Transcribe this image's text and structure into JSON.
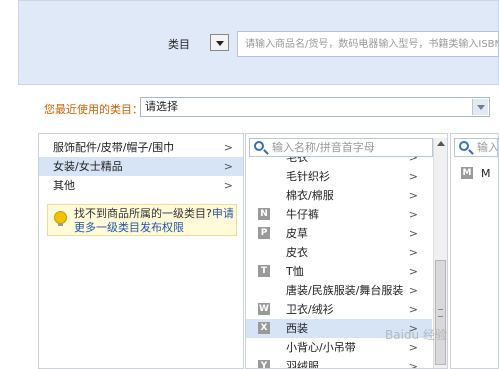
{
  "search": {
    "category_label": "类目",
    "placeholder": "请输入商品名/货号，数码电器输入型号，书籍类输入ISBN"
  },
  "recent": {
    "label": "您最近使用的类目：",
    "value": "请选择"
  },
  "level1": {
    "items": [
      {
        "label": "服饰配件/皮带/帽子/围巾",
        "selected": false
      },
      {
        "label": "女装/女士精品",
        "selected": true
      },
      {
        "label": "其他",
        "selected": false
      }
    ],
    "hint": {
      "text": "找不到商品所属的一级类目?",
      "link": "申请更多一级类目发布权限"
    }
  },
  "level2": {
    "search_placeholder": "输入名称/拼音首字母",
    "items": [
      {
        "letter": "",
        "label": "毛衣"
      },
      {
        "letter": "",
        "label": "毛针织衫"
      },
      {
        "letter": "",
        "label": "棉衣/棉服"
      },
      {
        "letter": "N",
        "label": "牛仔裤"
      },
      {
        "letter": "P",
        "label": "皮草"
      },
      {
        "letter": "",
        "label": "皮衣"
      },
      {
        "letter": "T",
        "label": "T恤"
      },
      {
        "letter": "",
        "label": "唐装/民族服装/舞台服装"
      },
      {
        "letter": "W",
        "label": "卫衣/绒衫"
      },
      {
        "letter": "X",
        "label": "西装",
        "selected": true
      },
      {
        "letter": "",
        "label": "小背心/小吊带"
      },
      {
        "letter": "Y",
        "label": "羽绒服"
      }
    ]
  },
  "level3": {
    "search_placeholder": "输入",
    "items": [
      {
        "letter": "M",
        "label": "M"
      }
    ]
  },
  "watermark": "Baidu 经验"
}
